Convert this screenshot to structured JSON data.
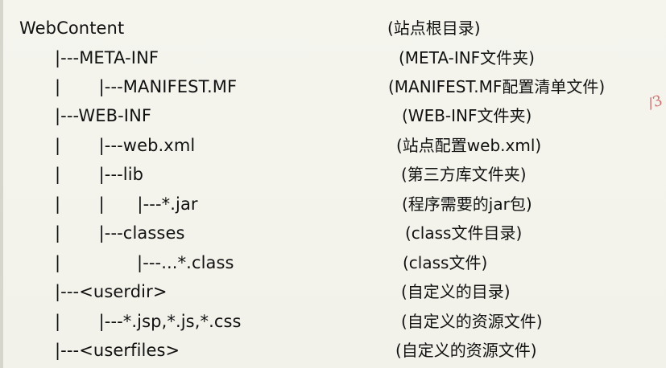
{
  "tree": {
    "rows": [
      {
        "path": "WebContent",
        "desc": "(站点根目录)"
      },
      {
        "path": "|---META-INF",
        "desc": "(META-INF文件夹)"
      },
      {
        "path": "|       |---MANIFEST.MF",
        "desc": "(MANIFEST.MF配置清单文件)"
      },
      {
        "path": "|---WEB-INF",
        "desc": "(WEB-INF文件夹)"
      },
      {
        "path": "|       |---web.xml",
        "desc": "(站点配置web.xml)"
      },
      {
        "path": "|       |---lib",
        "desc": "(第三方库文件夹)"
      },
      {
        "path": "|       |      |---*.jar",
        "desc": "(程序需要的jar包)"
      },
      {
        "path": "|       |---classes",
        "desc": "(class文件目录)"
      },
      {
        "path": "|              |---...*.class",
        "desc": "(class文件)"
      },
      {
        "path": "|---<userdir>",
        "desc": "(自定义的目录)"
      },
      {
        "path": "|       |---*.jsp,*.js,*.css",
        "desc": "(自定义的资源文件)"
      },
      {
        "path": "|---<userfiles>",
        "desc": "(自定义的资源文件)"
      }
    ],
    "margin_mark": "/3"
  }
}
